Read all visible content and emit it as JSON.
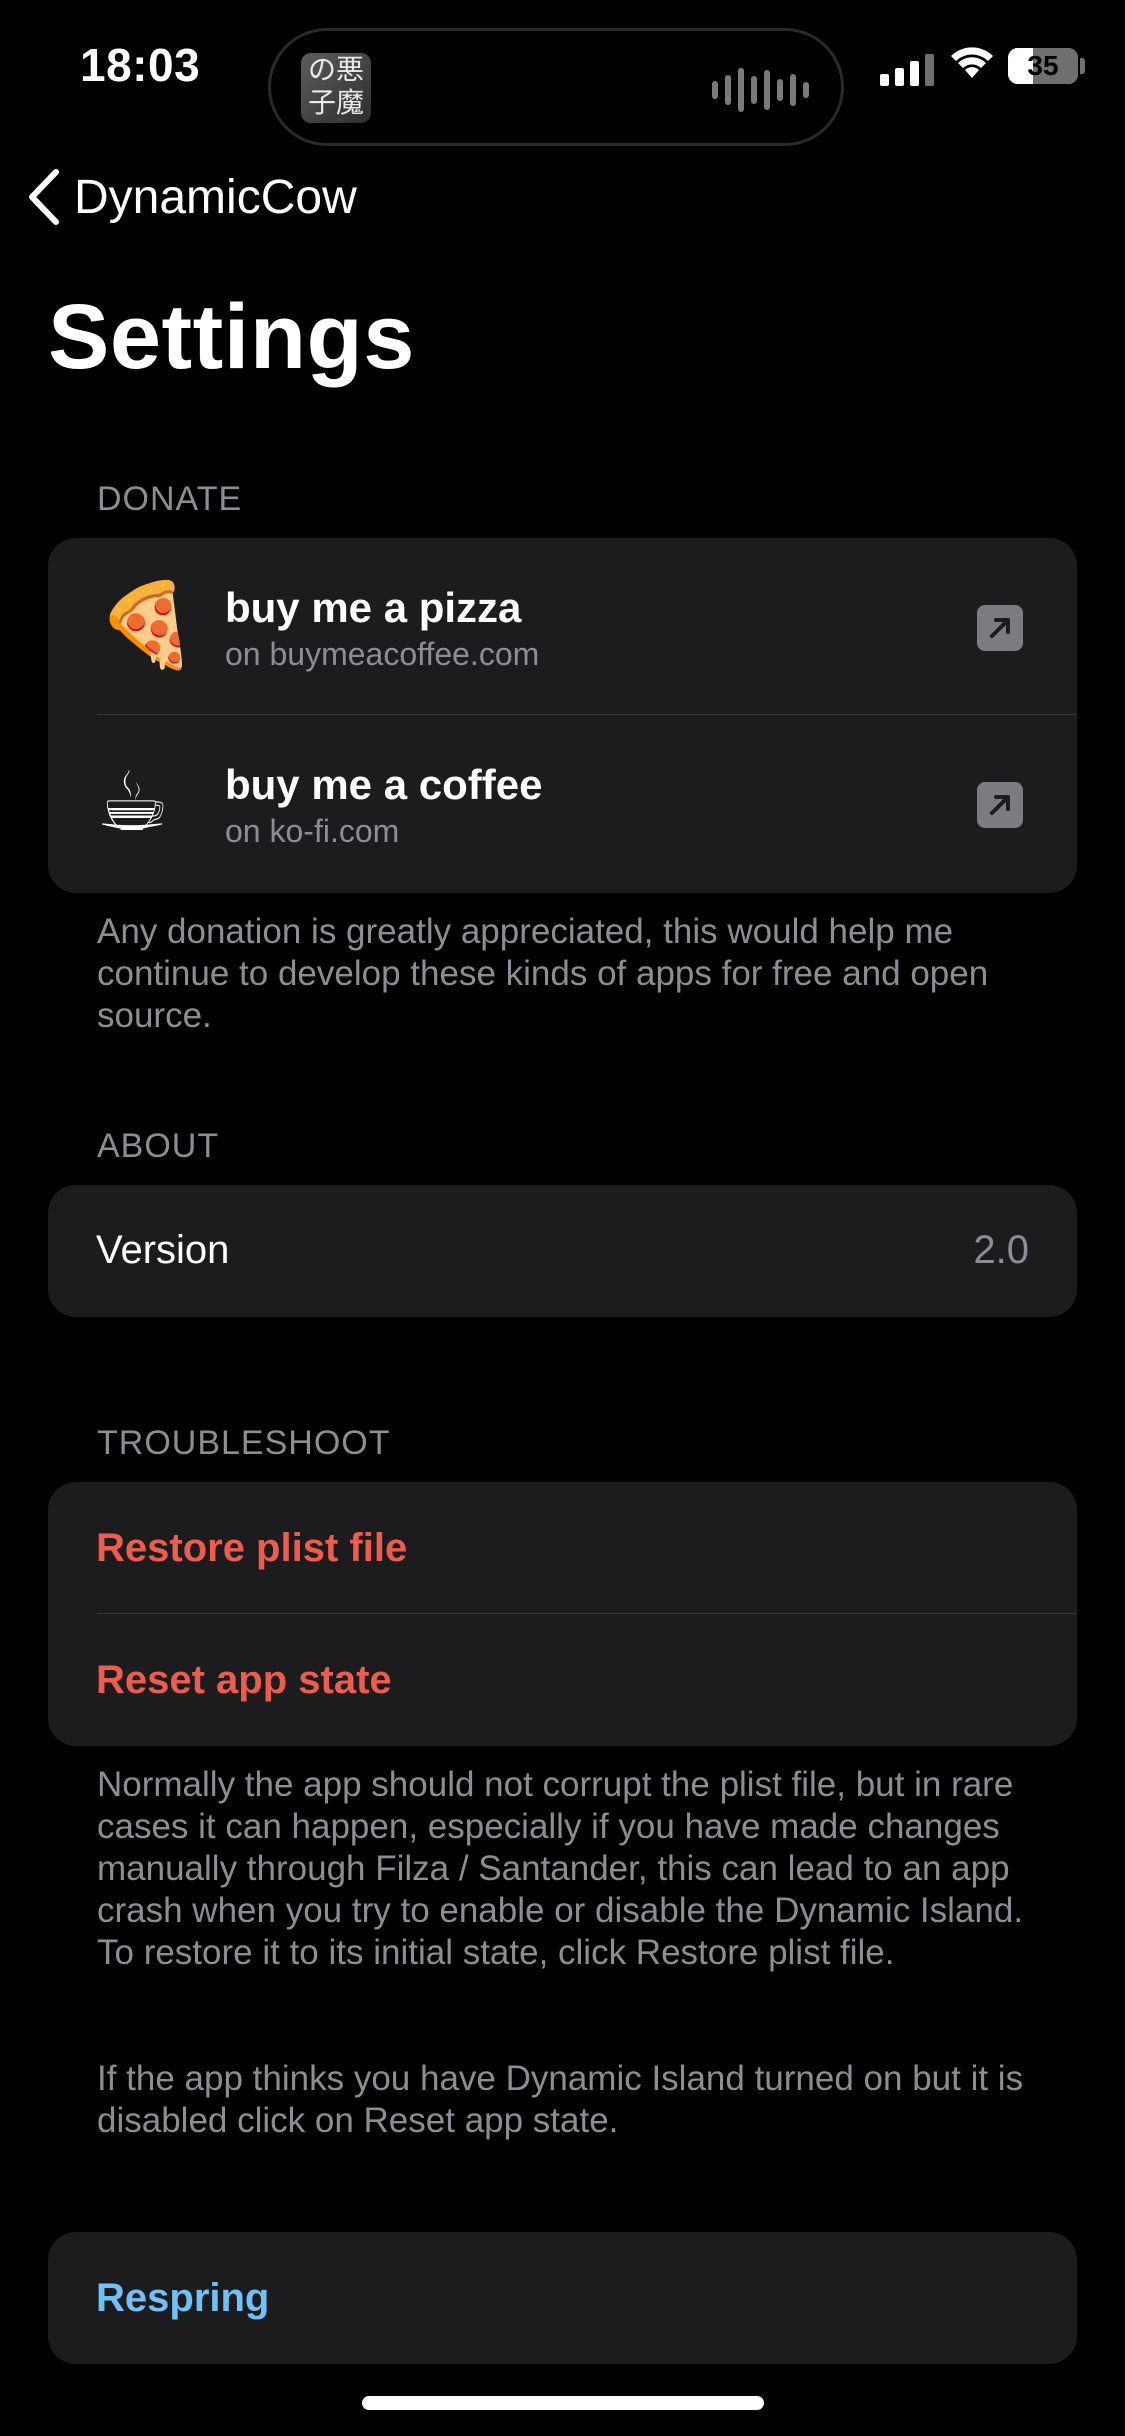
{
  "status_bar": {
    "time": "18:03",
    "battery": "35"
  },
  "island": {
    "art_text": "の悪\n子魔"
  },
  "nav": {
    "back_label": "DynamicCow"
  },
  "page_title": "Settings",
  "donate": {
    "header": "DONATE",
    "items": [
      {
        "emoji": "🍕",
        "title": "buy me a pizza",
        "subtitle": "on buymeacoffee.com",
        "icon": "arrow-up-right-square-icon"
      },
      {
        "emoji": "☕",
        "title": "buy me a coffee",
        "subtitle": "on ko-fi.com",
        "icon": "arrow-up-right-square-icon"
      }
    ],
    "footer": "Any donation is greatly appreciated, this would help me continue to develop these kinds of apps for free and open source."
  },
  "about": {
    "header": "ABOUT",
    "version_label": "Version",
    "version_value": "2.0"
  },
  "troubleshoot": {
    "header": "TROUBLESHOOT",
    "restore_label": "Restore plist file",
    "reset_label": "Reset app state",
    "footer_1": "Normally the app should not corrupt the plist file, but in rare cases it can happen, especially if you have made changes manually through Filza / Santander, this can lead to an app crash when you try to enable or disable the Dynamic Island. To restore it to its initial state, click Restore plist file.",
    "footer_2": "If the app thinks you have Dynamic Island turned on but it is disabled click on Reset app state."
  },
  "respring_label": "Respring",
  "colors": {
    "background": "#000000",
    "card": "#1c1c1e",
    "destructive": "#ec5d4e",
    "link": "#6fc1f7",
    "secondary_text": "#8d8d93"
  }
}
